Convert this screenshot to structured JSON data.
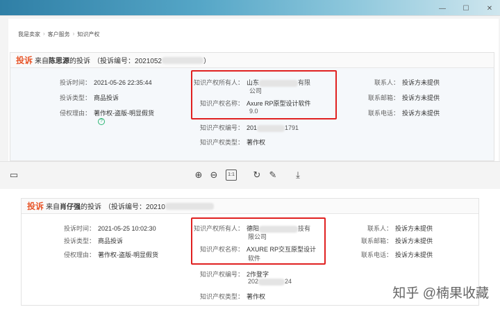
{
  "window": {
    "min": "—",
    "max": "☐",
    "close": "✕"
  },
  "breadcrumb": [
    "我是卖家",
    "客户服务",
    "知识产权"
  ],
  "top": {
    "tag": "投诉",
    "from_prefix": "来自",
    "from_name": "陈思源",
    "from_suffix": "的投诉",
    "code_label": "（投诉编号：2021052",
    "code_end": "）",
    "time_label": "投诉时间：",
    "time_value": "2021-05-26 22:35:44",
    "type_label": "投诉类型：",
    "type_value": "商品投诉",
    "reason_label": "侵权理由：",
    "reason_value": "著作权-盗版-明显假货",
    "owner_label": "知识产权所有人：",
    "owner_v1": "山东",
    "owner_v2": "有限",
    "owner_v3": "公司",
    "ipname_label": "知识产权名称：",
    "ipname_v1": "Axure RP原型设计软件",
    "ipname_v2": "9.0",
    "ipno_label": "知识产权编号：",
    "ipno_v1": "201",
    "ipno_v2": "1791",
    "iptype_label": "知识产权类型：",
    "iptype_value": "著作权",
    "contact_label": "联系人：",
    "contact_value": "投诉方未提供",
    "email_label": "联系邮箱：",
    "email_value": "投诉方未提供",
    "phone_label": "联系电话：",
    "phone_value": "投诉方未提供"
  },
  "bottom": {
    "tag": "投诉",
    "from_prefix": "来自",
    "from_name": "肖仔强",
    "from_suffix": "的投诉",
    "code_label": "（投诉编号：20210",
    "time_label": "投诉时间：",
    "time_value": "2021-05-25 10:02:30",
    "type_label": "投诉类型：",
    "type_value": "商品投诉",
    "reason_label": "侵权理由：",
    "reason_value": "著作权-盗版-明显假货",
    "owner_label": "知识产权所有人：",
    "owner_v1": "德阳",
    "owner_v2": "技有",
    "owner_v3": "限公司",
    "ipname_label": "知识产权名称：",
    "ipname_v1": "AXURE RP交互原型设计",
    "ipname_v2": "软件",
    "ipno_label": "知识产权编号：",
    "ipno_v1": "2作登字",
    "ipno_v2": "202",
    "ipno_v3": "24",
    "iptype_label": "知识产权类型：",
    "iptype_value": "著作权",
    "contact_label": "联系人：",
    "contact_value": "投诉方未提供",
    "email_label": "联系邮箱：",
    "email_value": "投诉方未提供",
    "phone_label": "联系电话：",
    "phone_value": "投诉方未提供"
  },
  "watermark": "知乎 @楠果收藏",
  "toolbar": {
    "fit": "1:1"
  }
}
